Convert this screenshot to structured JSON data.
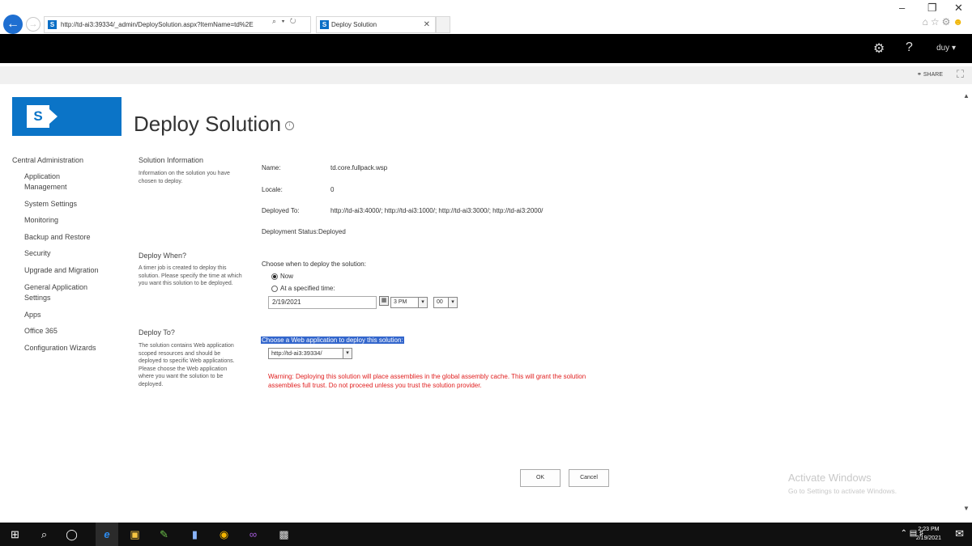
{
  "browser": {
    "address": "http://td-ai3:39334/_admin/DeploySolution.aspx?ItemName=td%2E",
    "tab_title": "Deploy Solution",
    "window_controls": [
      "–",
      "❐",
      "✕"
    ]
  },
  "suite_bar": {
    "user": "duy"
  },
  "ribbon": {
    "share_label": "SHARE"
  },
  "page": {
    "title": "Deploy Solution"
  },
  "nav": {
    "heading": "Central Administration",
    "items": [
      "Application Management",
      "System Settings",
      "Monitoring",
      "Backup and Restore",
      "Security",
      "Upgrade and Migration",
      "General Application Settings",
      "Apps",
      "Office 365",
      "Configuration Wizards"
    ]
  },
  "sections": {
    "info": {
      "title": "Solution Information",
      "desc": "Information on the solution you have chosen to deploy."
    },
    "when": {
      "title": "Deploy When?",
      "desc": "A timer job is created to deploy this solution. Please specify the time at which you want this solution to be deployed."
    },
    "to": {
      "title": "Deploy To?",
      "desc": "The solution contains Web application scoped resources and should be deployed to specific Web applications. Please choose the Web application where you want the solution to be deployed."
    }
  },
  "solution": {
    "name_label": "Name:",
    "name": "td.core.fullpack.wsp",
    "locale_label": "Locale:",
    "locale": "0",
    "deployed_to_label": "Deployed To:",
    "deployed_to": "http://td-ai3:4000/; http://td-ai3:1000/; http://td-ai3:3000/; http://td-ai3:2000/",
    "status_label": "Deployment Status:",
    "status": "Deployed"
  },
  "deploy_when": {
    "prompt": "Choose when to deploy the solution:",
    "option_now": "Now",
    "option_specified": "At a specified time:",
    "selected": "Now",
    "date": "2/19/2021",
    "hour": "3 PM",
    "minute": "00"
  },
  "deploy_to": {
    "prompt": "Choose a Web application to deploy this solution:",
    "selected": "http://td-ai3:39334/",
    "warning": "Warning: Deploying this solution will place assemblies in the global assembly cache. This will grant the solution assemblies full trust. Do not proceed unless you trust the solution provider."
  },
  "buttons": {
    "ok": "OK",
    "cancel": "Cancel"
  },
  "watermark": {
    "line1": "Activate Windows",
    "line2": "Go to Settings to activate Windows."
  },
  "taskbar": {
    "time": "2:23 PM",
    "date": "2/19/2021"
  },
  "colors": {
    "suite_bar": "#000000",
    "accent": "#0b74c7",
    "selection_highlight": "#3366cc",
    "warning": "#e02020"
  }
}
